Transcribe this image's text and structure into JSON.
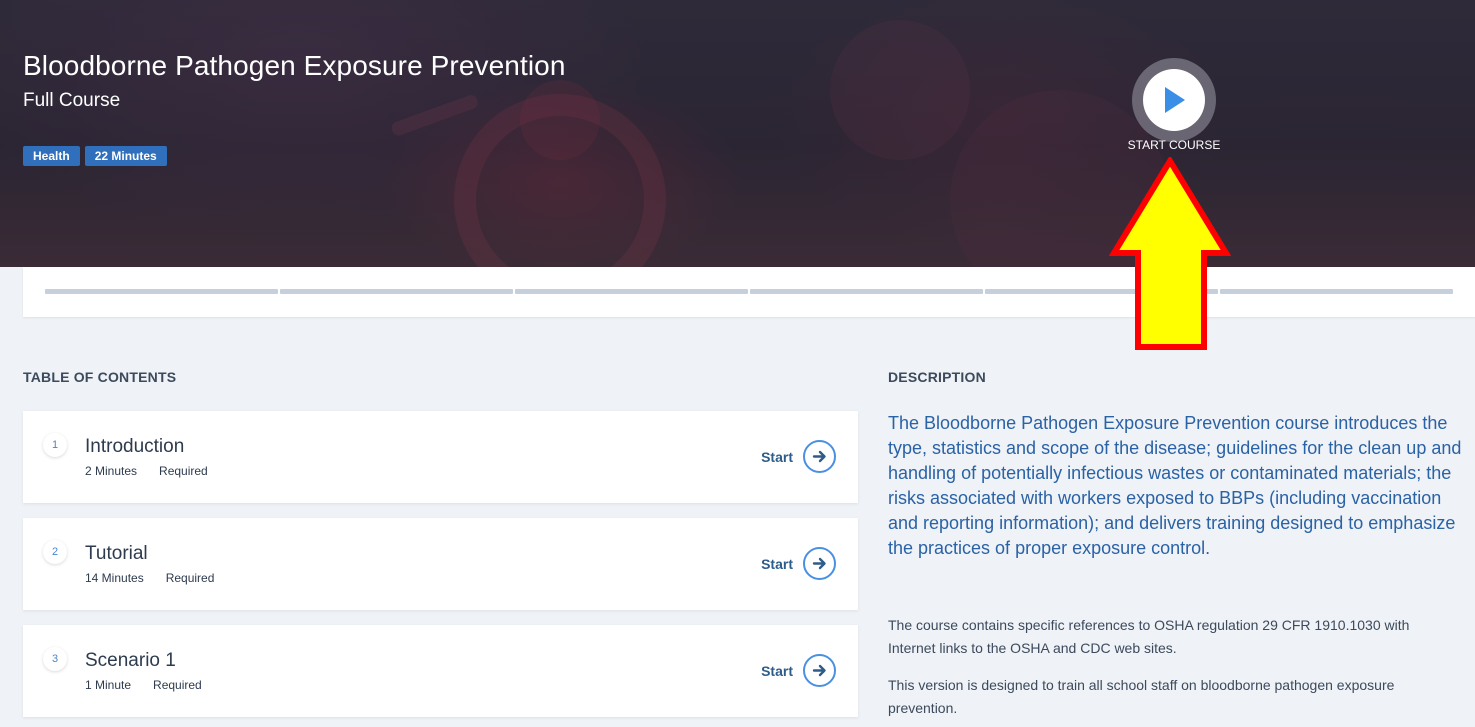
{
  "hero": {
    "title": "Bloodborne Pathogen Exposure Prevention",
    "subtitle": "Full Course",
    "tags": [
      "Health",
      "22 Minutes"
    ],
    "start_course_label": "START COURSE",
    "play_icon": "play-icon",
    "tag_color": "#2f6fbc"
  },
  "progress": {
    "segments": 6
  },
  "annotation": {
    "arrow_fill": "#ffff00",
    "arrow_stroke": "#ff0000"
  },
  "toc": {
    "heading": "TABLE OF CONTENTS",
    "start_label": "Start",
    "items": [
      {
        "number": "1",
        "title": "Introduction",
        "duration": "2 Minutes",
        "status": "Required"
      },
      {
        "number": "2",
        "title": "Tutorial",
        "duration": "14 Minutes",
        "status": "Required"
      },
      {
        "number": "3",
        "title": "Scenario 1",
        "duration": "1 Minute",
        "status": "Required"
      }
    ]
  },
  "description": {
    "heading": "DESCRIPTION",
    "lead": "The Bloodborne Pathogen Exposure Prevention course introduces the type, statistics and scope of the disease; guidelines for the clean up and handling of potentially infectious wastes or contaminated materials; the risks associated with workers exposed to BBPs (including vaccination and reporting information); and delivers training designed to emphasize the practices of proper exposure control.",
    "paragraphs": [
      "The course contains specific references to OSHA regulation 29 CFR 1910.1030 with Internet links to the OSHA and CDC web sites.",
      "This version is designed to train all school staff on bloodborne pathogen exposure prevention."
    ]
  }
}
